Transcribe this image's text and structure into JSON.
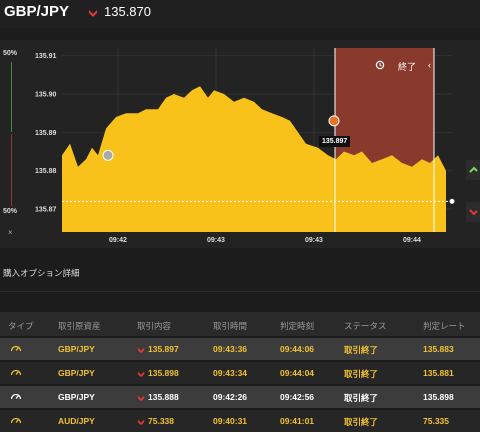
{
  "header": {
    "pair": "GBP/JPY",
    "price": "135.870",
    "direction_icon": "down-arrow-icon",
    "direction_color": "#e53935"
  },
  "chart": {
    "meter_top": "50%",
    "meter_bottom": "50%",
    "meter_close": "×",
    "end_label": "終了",
    "tag": "135.897",
    "end_chevron": "‹",
    "colors": {
      "area": "#f8c21a",
      "expiry_zone": "#8a3a2c",
      "background": "#232323"
    }
  },
  "chart_data": {
    "type": "area",
    "y_ticks": [
      "135.91",
      "135.90",
      "135.89",
      "135.88",
      "135.87"
    ],
    "x_ticks": [
      "09:42",
      "09:43",
      "09:43",
      "09:44"
    ],
    "ylim": [
      135.864,
      135.912
    ],
    "series": [
      {
        "values": [
          [
            0,
            135.884
          ],
          [
            8,
            135.887
          ],
          [
            16,
            135.881
          ],
          [
            24,
            135.883
          ],
          [
            30,
            135.886
          ],
          [
            36,
            135.884
          ],
          [
            44,
            135.891
          ],
          [
            54,
            135.894
          ],
          [
            64,
            135.895
          ],
          [
            76,
            135.895
          ],
          [
            84,
            135.896
          ],
          [
            96,
            135.896
          ],
          [
            104,
            135.899
          ],
          [
            112,
            135.9
          ],
          [
            122,
            135.899
          ],
          [
            130,
            135.901
          ],
          [
            138,
            135.902
          ],
          [
            146,
            135.899
          ],
          [
            152,
            135.901
          ],
          [
            162,
            135.9
          ],
          [
            172,
            135.898
          ],
          [
            182,
            135.899
          ],
          [
            192,
            135.898
          ],
          [
            200,
            135.896
          ],
          [
            210,
            135.895
          ],
          [
            220,
            135.894
          ],
          [
            228,
            135.893
          ],
          [
            236,
            135.89
          ],
          [
            244,
            135.887
          ],
          [
            256,
            135.886
          ],
          [
            266,
            135.884
          ],
          [
            274,
            135.883
          ],
          [
            282,
            135.885
          ],
          [
            292,
            135.884
          ],
          [
            300,
            135.885
          ],
          [
            310,
            135.882
          ],
          [
            320,
            135.883
          ],
          [
            330,
            135.884
          ],
          [
            340,
            135.882
          ],
          [
            350,
            135.881
          ],
          [
            360,
            135.883
          ],
          [
            368,
            135.882
          ],
          [
            376,
            135.884
          ],
          [
            384,
            135.88
          ]
        ]
      }
    ],
    "markers": [
      {
        "label": "entry-1",
        "x": 40,
        "y": 135.884,
        "color": "#aaaaaa"
      },
      {
        "label": "entry-2",
        "x": 266,
        "y": 135.893,
        "color": "#e8742a"
      }
    ],
    "current_price": 135.872
  },
  "details": {
    "title": "購入オプション詳細",
    "headers": [
      "タイプ",
      "取引原資産",
      "取引内容",
      "取引時間",
      "判定時刻",
      "ステータス",
      "判定レート"
    ],
    "rows": [
      {
        "type_icon": "timer-icon",
        "asset": "GBP/JPY",
        "content": "135.897",
        "trade_time": "09:43:36",
        "judge_time": "09:44:06",
        "status": "取引終了",
        "rate": "135.883",
        "style": "b",
        "white": false
      },
      {
        "type_icon": "timer-icon",
        "asset": "GBP/JPY",
        "content": "135.898",
        "trade_time": "09:43:34",
        "judge_time": "09:44:04",
        "status": "取引終了",
        "rate": "135.881",
        "style": "a",
        "white": false
      },
      {
        "type_icon": "timer-icon",
        "asset": "GBP/JPY",
        "content": "135.888",
        "trade_time": "09:42:26",
        "judge_time": "09:42:56",
        "status": "取引終了",
        "rate": "135.898",
        "style": "b",
        "white": true
      },
      {
        "type_icon": "timer-icon",
        "asset": "AUD/JPY",
        "content": "75.338",
        "trade_time": "09:40:31",
        "judge_time": "09:41:01",
        "status": "取引終了",
        "rate": "75.335",
        "style": "a",
        "white": false
      }
    ]
  }
}
